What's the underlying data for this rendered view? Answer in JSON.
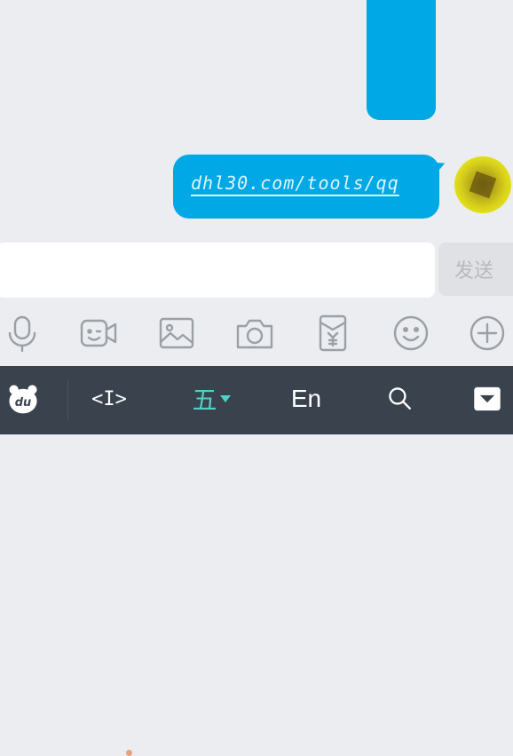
{
  "chat": {
    "message_link": "dhl30.com/tools/qq"
  },
  "composer": {
    "input_value": "",
    "send_label": "发送"
  },
  "toolbar": {
    "icons": [
      "microphone-icon",
      "video-icon",
      "image-icon",
      "camera-icon",
      "red-packet-icon",
      "emoji-icon",
      "plus-icon"
    ]
  },
  "keyboard_bar": {
    "logo_text": "du",
    "cursor_label": "<I>",
    "input_method_label": "五",
    "language_label": "En",
    "search_icon": "search-icon",
    "collapse_icon": "collapse-keyboard-icon"
  },
  "colors": {
    "bubble": "#00a8e6",
    "keyboard_bar": "#3a434d",
    "wubi_accent": "#4fd2c4"
  }
}
